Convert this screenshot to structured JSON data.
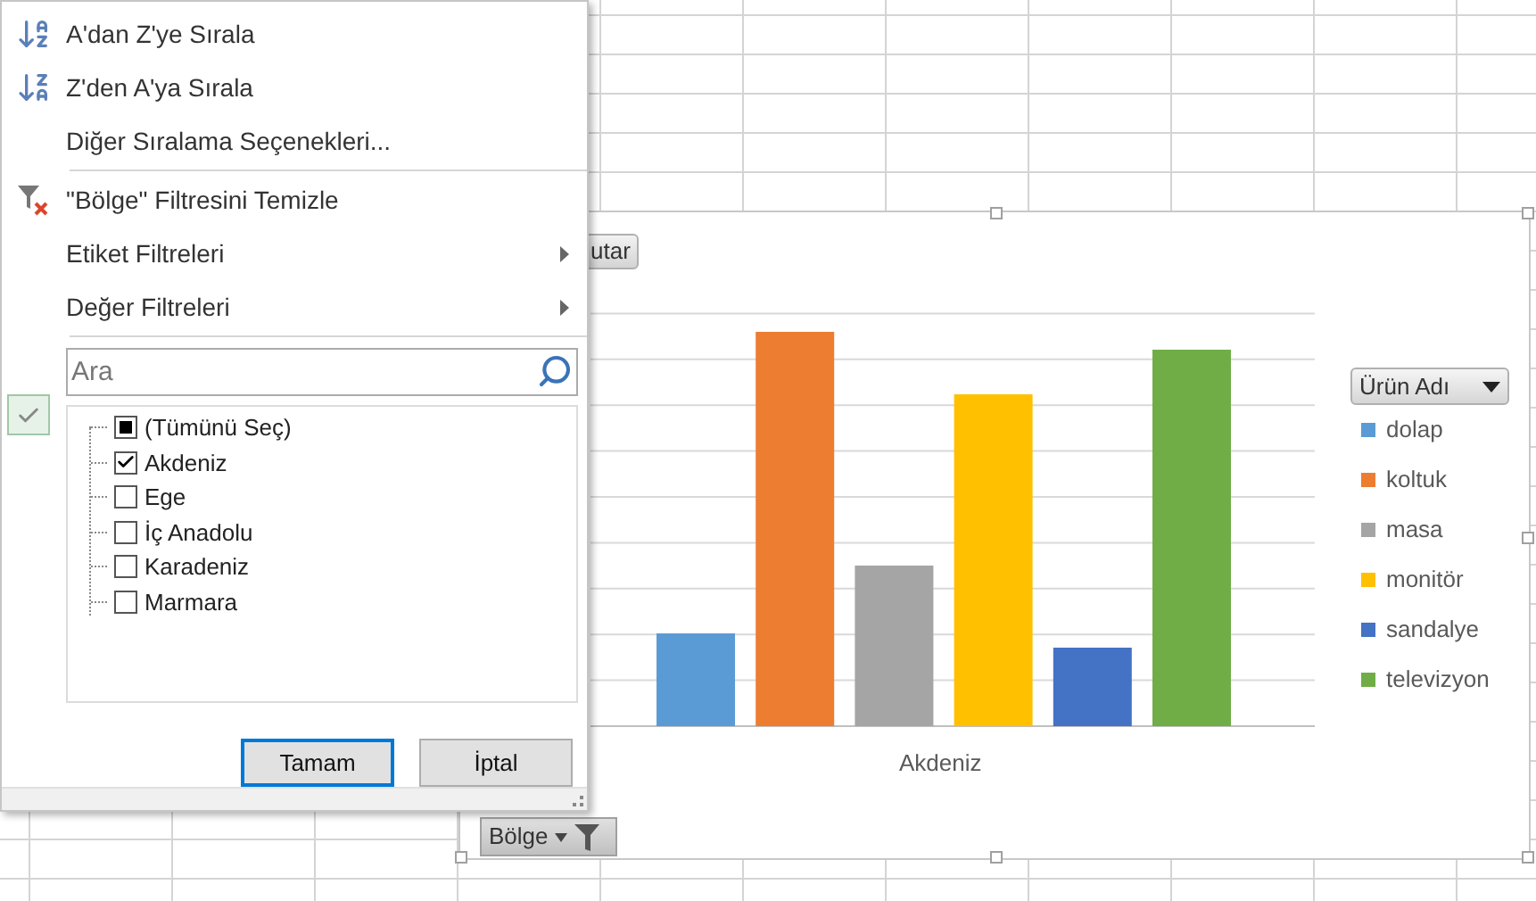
{
  "menu": {
    "items": [
      {
        "kind": "sort_asc",
        "label": "A'dan Z'ye Sırala"
      },
      {
        "kind": "sort_desc",
        "label": "Z'den A'ya Sırala"
      },
      {
        "kind": "plain",
        "label": "Diğer Sıralama Seçenekleri..."
      },
      {
        "kind": "separator"
      },
      {
        "kind": "clear_filter",
        "label": "\"Bölge\" Filtresini Temizle"
      },
      {
        "kind": "submenu",
        "label": "Etiket Filtreleri"
      },
      {
        "kind": "submenu",
        "label": "Değer Filtreleri"
      },
      {
        "kind": "separator"
      }
    ],
    "search": {
      "placeholder": "Ara"
    },
    "values": [
      {
        "label": "(Tümünü Seç)",
        "checked": false,
        "indeterminate": true
      },
      {
        "label": "Akdeniz",
        "checked": true,
        "indeterminate": false
      },
      {
        "label": "Ege",
        "checked": false,
        "indeterminate": false
      },
      {
        "label": "İç Anadolu",
        "checked": false,
        "indeterminate": false
      },
      {
        "label": "Karadeniz",
        "checked": false,
        "indeterminate": false
      },
      {
        "label": "Marmara",
        "checked": false,
        "indeterminate": false
      }
    ],
    "buttons": [
      {
        "label": "Tamam",
        "default": true
      },
      {
        "label": "İptal",
        "default": false
      }
    ]
  },
  "chart": {
    "value_field_button": "utar",
    "category": "Akdeniz",
    "axis_field_button": "Bölge",
    "legend": {
      "field_button": "Ürün Adı",
      "items": [
        {
          "label": "dolap",
          "color": "#5b9bd5"
        },
        {
          "label": "koltuk",
          "color": "#ed7d31"
        },
        {
          "label": "masa",
          "color": "#a5a5a5"
        },
        {
          "label": "monitör",
          "color": "#ffc000"
        },
        {
          "label": "sandalye",
          "color": "#4472c4"
        },
        {
          "label": "televizyon",
          "color": "#70ad47"
        }
      ]
    }
  }
}
